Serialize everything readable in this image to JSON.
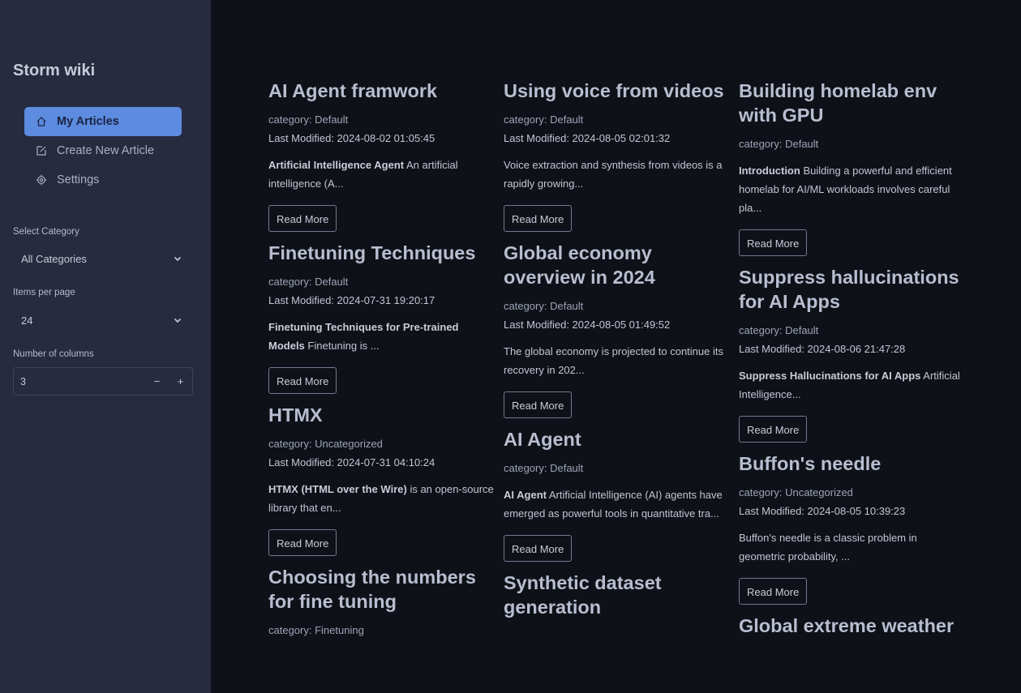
{
  "sidebar": {
    "title": "Storm wiki",
    "nav": [
      {
        "label": "My Articles",
        "icon": "home-icon"
      },
      {
        "label": "Create New Article",
        "icon": "edit-icon"
      },
      {
        "label": "Settings",
        "icon": "gear-icon"
      }
    ],
    "category": {
      "label": "Select Category",
      "value": "All Categories"
    },
    "per_page": {
      "label": "Items per page",
      "value": "24"
    },
    "columns": {
      "label": "Number of columns",
      "value": "3",
      "minus": "−",
      "plus": "+"
    }
  },
  "read_more": "Read More",
  "articles": [
    {
      "title": "AI Agent framwork",
      "category": "category: Default",
      "modified": "Last Modified: 2024-08-02 01:05:45",
      "lead": "Artificial Intelligence Agent",
      "text": " An artificial intelligence (A..."
    },
    {
      "title": "Finetuning Techniques",
      "category": "category: Default",
      "modified": "Last Modified: 2024-07-31 19:20:17",
      "lead": "Finetuning Techniques for Pre-trained Models",
      "text": " Finetuning is ..."
    },
    {
      "title": "HTMX",
      "category": "category: Uncategorized",
      "modified": "Last Modified: 2024-07-31 04:10:24",
      "lead": "HTMX (HTML over the Wire)",
      "text": " is an open-source library that en..."
    },
    {
      "title": "Choosing the numbers for fine tuning",
      "category": "category: Finetuning",
      "modified": "",
      "lead": "",
      "text": ""
    },
    {
      "title": "Using voice from videos",
      "category": "category: Default",
      "modified": "Last Modified: 2024-08-05 02:01:32",
      "lead": "",
      "text": "Voice extraction and synthesis from videos is a rapidly growing..."
    },
    {
      "title": "Global economy overview in 2024",
      "category": "category: Default",
      "modified": "Last Modified: 2024-08-05 01:49:52",
      "lead": "",
      "text": "The global economy is projected to continue its recovery in 202..."
    },
    {
      "title": "AI Agent",
      "category": "category: Default",
      "modified": "",
      "lead": "AI Agent",
      "text": " Artificial Intelligence (AI) agents have emerged as powerful tools in quantitative tra..."
    },
    {
      "title": "Synthetic dataset generation",
      "category": "",
      "modified": "",
      "lead": "",
      "text": ""
    },
    {
      "title": "Building homelab env with GPU",
      "category": "category: Default",
      "modified": "",
      "lead": "Introduction",
      "text": " Building a powerful and efficient homelab for AI/ML workloads involves careful pla..."
    },
    {
      "title": "Suppress hallucinations for AI Apps",
      "category": "category: Default",
      "modified": "Last Modified: 2024-08-06 21:47:28",
      "lead": "Suppress Hallucinations for AI Apps",
      "text": " Artificial Intelligence..."
    },
    {
      "title": "Buffon's needle",
      "category": "category: Uncategorized",
      "modified": "Last Modified: 2024-08-05 10:39:23",
      "lead": "",
      "text": "Buffon's needle is a classic problem in geometric probability, ..."
    },
    {
      "title": "Global extreme weather",
      "category": "",
      "modified": "",
      "lead": "",
      "text": ""
    }
  ]
}
